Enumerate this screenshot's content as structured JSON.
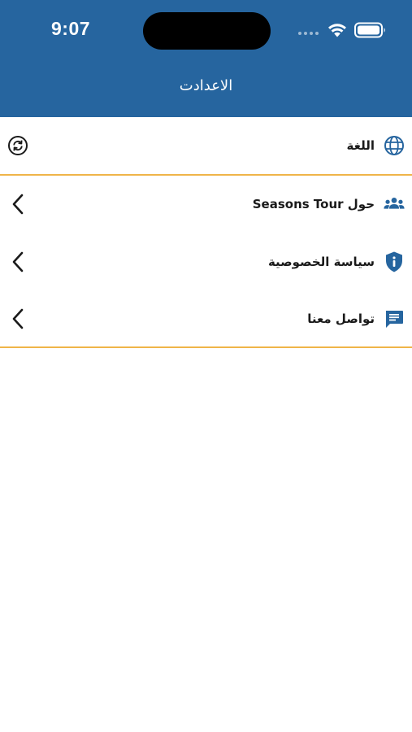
{
  "status_bar": {
    "time": "9:07"
  },
  "header": {
    "title": "الاعدادت"
  },
  "language_row": {
    "label": "اللغة",
    "icon": "globe-icon",
    "action_icon": "sync-icon"
  },
  "menu": {
    "items": [
      {
        "label": "حول Seasons Tour",
        "icon": "group-icon"
      },
      {
        "label": "سياسة الخصوصية",
        "icon": "shield-info-icon"
      },
      {
        "label": "تواصل معنا",
        "icon": "message-icon"
      }
    ]
  },
  "colors": {
    "header_bg": "#26659f",
    "accent_divider": "#efb549",
    "icon_blue": "#26659f"
  }
}
